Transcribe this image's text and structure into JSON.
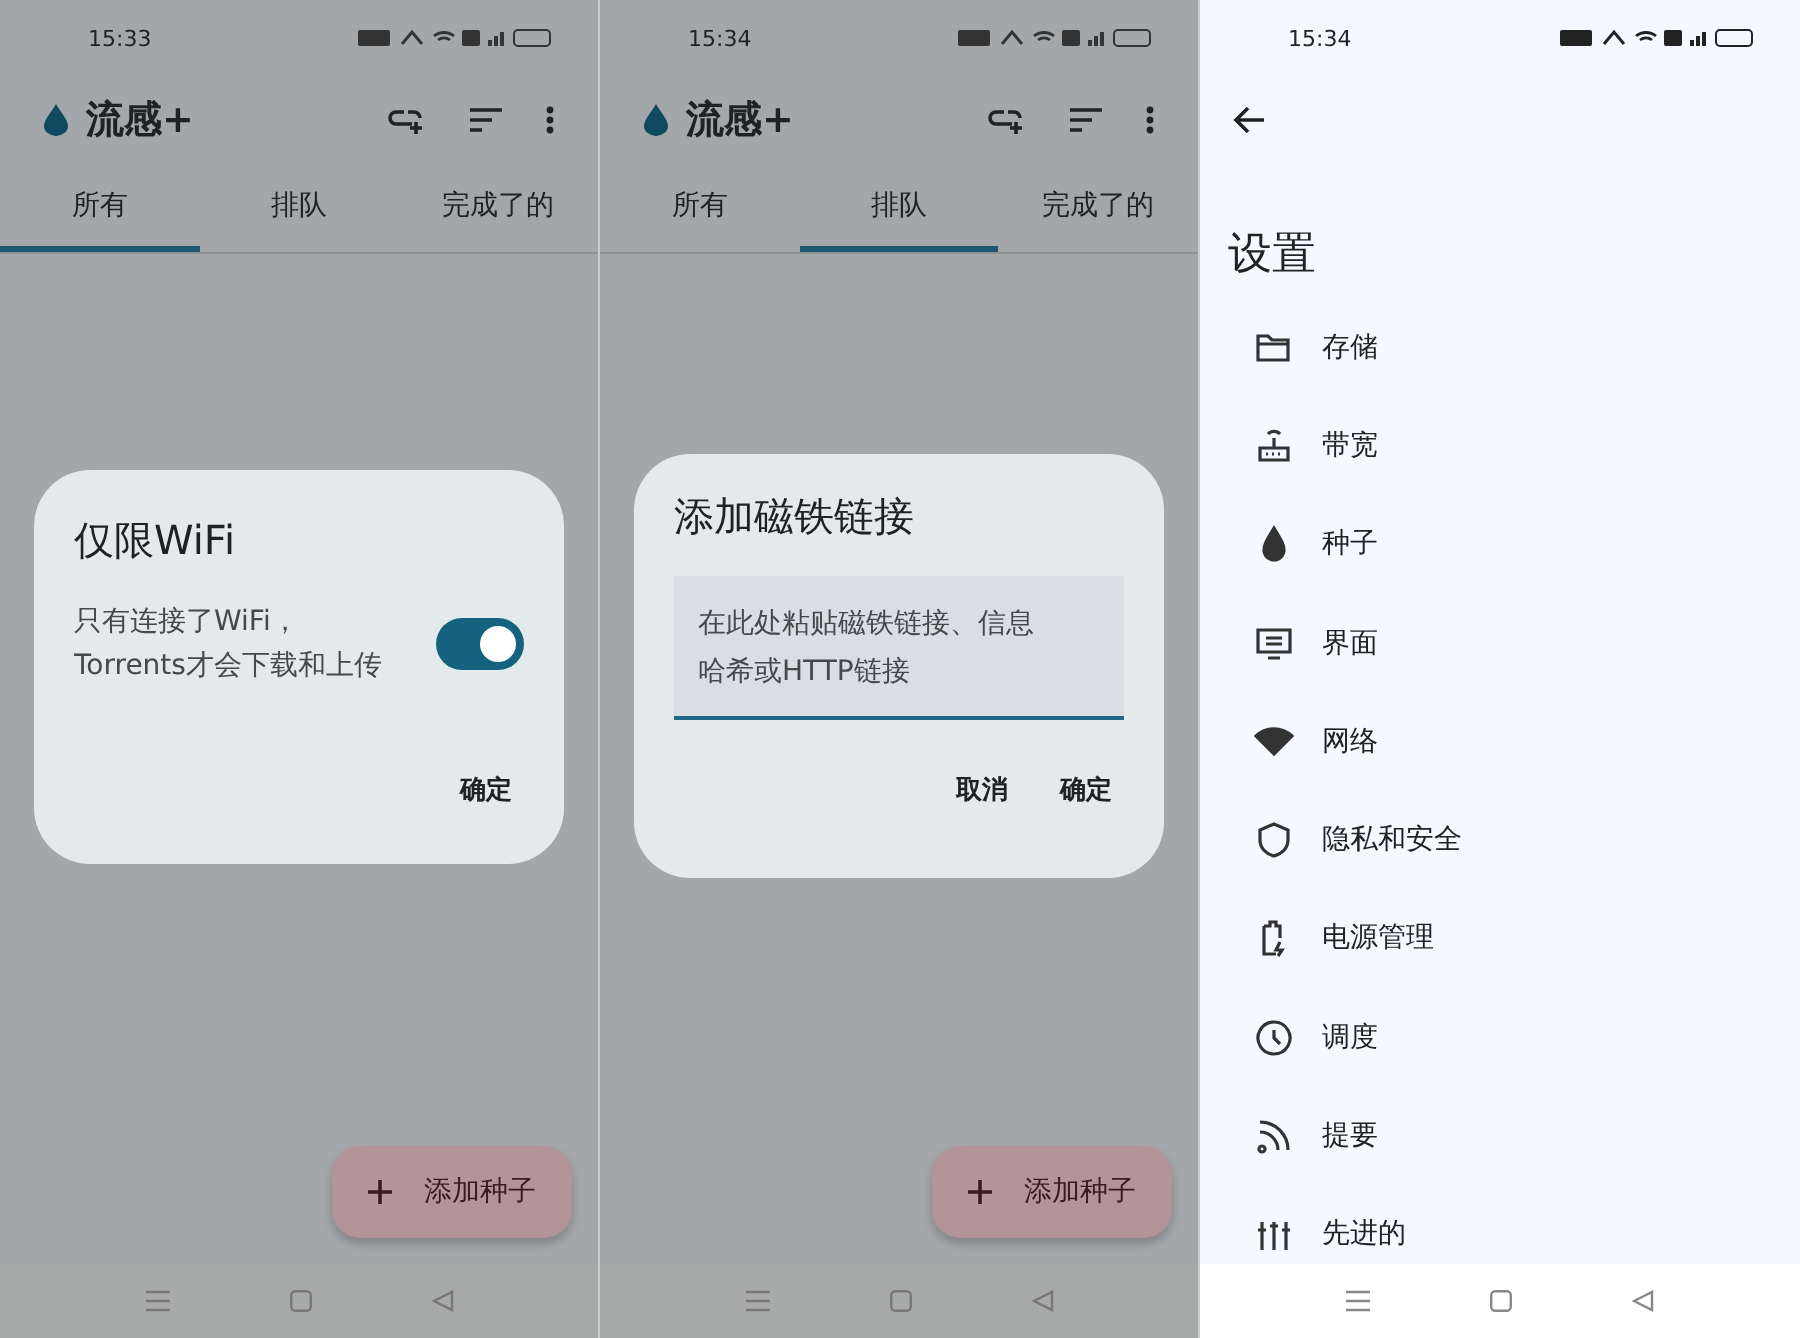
{
  "screens": [
    {
      "kind": "main",
      "status_bar": {
        "time": "15:33"
      },
      "app_bar": {
        "title": "流感+"
      },
      "tabs": [
        {
          "label": "所有",
          "selected": true
        },
        {
          "label": "排队",
          "selected": false
        },
        {
          "label": "完成了的",
          "selected": false
        }
      ],
      "fab": {
        "label": "添加种子"
      },
      "dialog": {
        "kind": "switch",
        "title": "仅限WiFi",
        "text": "只有连接了WiFi，\nTorrents才会下载和上传",
        "on": true,
        "buttons": [
          "确定"
        ]
      }
    },
    {
      "kind": "main",
      "status_bar": {
        "time": "15:34"
      },
      "app_bar": {
        "title": "流感+"
      },
      "tabs": [
        {
          "label": "所有",
          "selected": false
        },
        {
          "label": "排队",
          "selected": true
        },
        {
          "label": "完成了的",
          "selected": false
        }
      ],
      "fab": {
        "label": "添加种子"
      },
      "dialog": {
        "kind": "input",
        "title": "添加磁铁链接",
        "placeholder": "在此处粘贴磁铁链接、信息哈希或HTTP链接",
        "buttons": [
          "取消",
          "确定"
        ]
      }
    },
    {
      "kind": "settings",
      "status_bar": {
        "time": "15:34"
      },
      "title": "设置",
      "items": [
        {
          "label": "存储"
        },
        {
          "label": "带宽"
        },
        {
          "label": "种子"
        },
        {
          "label": "界面"
        },
        {
          "label": "网络"
        },
        {
          "label": "隐私和安全"
        },
        {
          "label": "电源管理"
        },
        {
          "label": "调度"
        },
        {
          "label": "提要"
        },
        {
          "label": "先进的"
        }
      ]
    }
  ]
}
